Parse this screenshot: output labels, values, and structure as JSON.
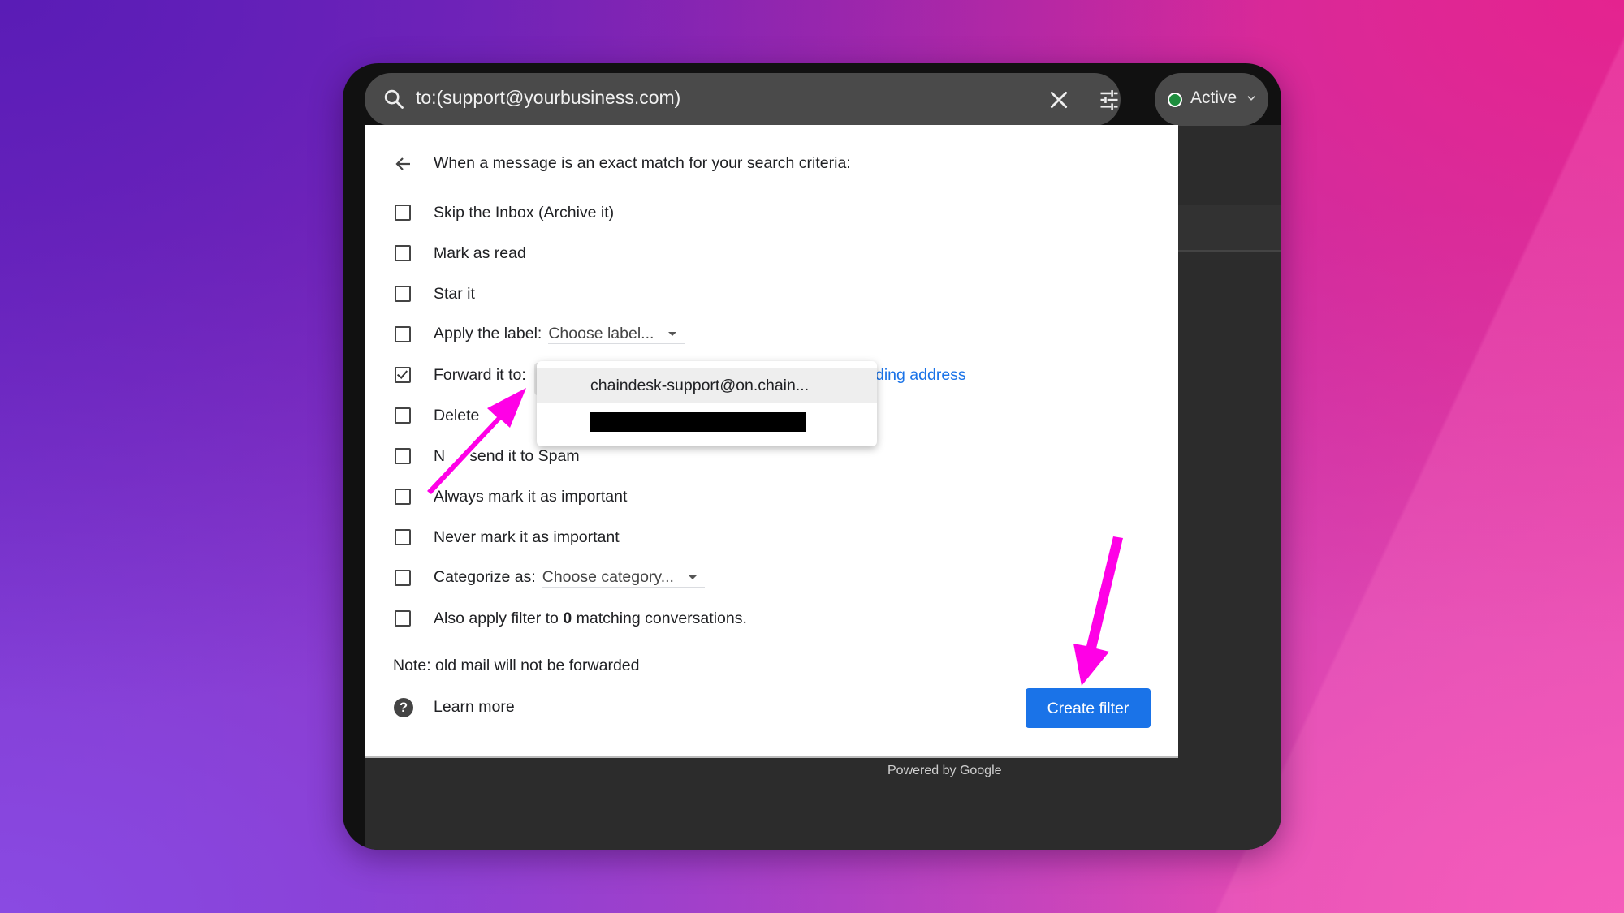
{
  "search": {
    "query": "to:(support@yourbusiness.com)",
    "icons": {
      "search": "search-icon",
      "clear": "close-icon",
      "options": "tune-icon"
    }
  },
  "status": {
    "label": "Active",
    "color": "#1e8e3e",
    "icon": "chevron-down-icon"
  },
  "filter": {
    "header": "When a message is an exact match for your search criteria:",
    "options": [
      {
        "label": "Skip the Inbox (Archive it)",
        "checked": false
      },
      {
        "label": "Mark as read",
        "checked": false
      },
      {
        "label": "Star it",
        "checked": false
      },
      {
        "label": "Apply the label:",
        "checked": false,
        "select": "Choose label..."
      },
      {
        "label": "Forward it to:",
        "checked": true,
        "link": "ding address"
      },
      {
        "label": "Delete",
        "checked": false
      },
      {
        "label": "N",
        "label_rest": "send it to Spam",
        "checked": false
      },
      {
        "label": "Always mark it as important",
        "checked": false
      },
      {
        "label": "Never mark it as important",
        "checked": false
      },
      {
        "label": "Categorize as:",
        "checked": false,
        "select": "Choose category..."
      },
      {
        "label_pre": "Also apply filter to ",
        "count": "0",
        "label_post": " matching conversations.",
        "checked": false
      }
    ],
    "forward_dropdown": {
      "options": [
        "chaindesk-support@on.chain...",
        "[redacted]"
      ],
      "highlighted": 0
    },
    "note": "Note: old mail will not be forwarded",
    "learn_more": "Learn more",
    "create_button": "Create filter"
  },
  "footer": {
    "powered_by": "Powered by Google"
  },
  "colors": {
    "accent": "#1a73e8",
    "annotation_arrow": "#ff00e6"
  }
}
